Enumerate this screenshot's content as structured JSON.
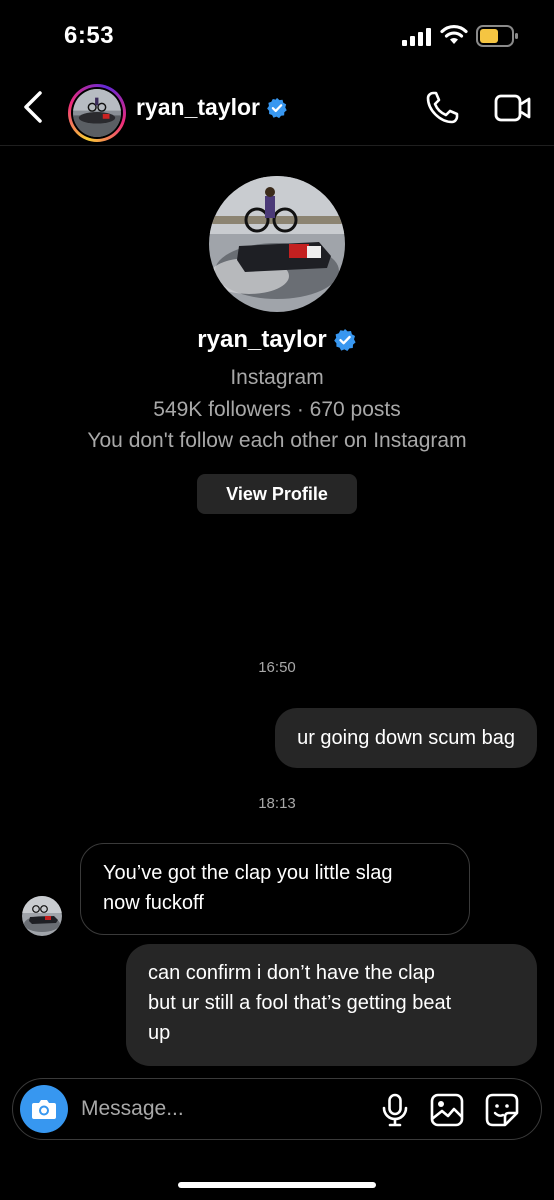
{
  "status_bar": {
    "time": "6:53"
  },
  "header": {
    "username": "ryan_taylor",
    "verified": true
  },
  "profile": {
    "username": "ryan_taylor",
    "subtitle": "Instagram",
    "stats": "549K followers · 670 posts",
    "relationship": "You don't follow each other on Instagram",
    "view_profile_label": "View Profile"
  },
  "messages": [
    {
      "type": "timestamp",
      "text": "16:50"
    },
    {
      "type": "outgoing",
      "text": "ur going down scum bag"
    },
    {
      "type": "timestamp",
      "text": "18:13"
    },
    {
      "type": "incoming",
      "lines": [
        "You’ve got the clap you little slag",
        "now fuckoff"
      ]
    },
    {
      "type": "outgoing",
      "lines": [
        "can confirm i don’t have the clap",
        "but ur still a fool that’s getting beat",
        "up"
      ]
    }
  ],
  "composer": {
    "placeholder": "Message..."
  },
  "colors": {
    "accent": "#3797f0",
    "bubble": "#262626",
    "secondary_text": "#a8a8a8",
    "verified": "#3897f0"
  }
}
